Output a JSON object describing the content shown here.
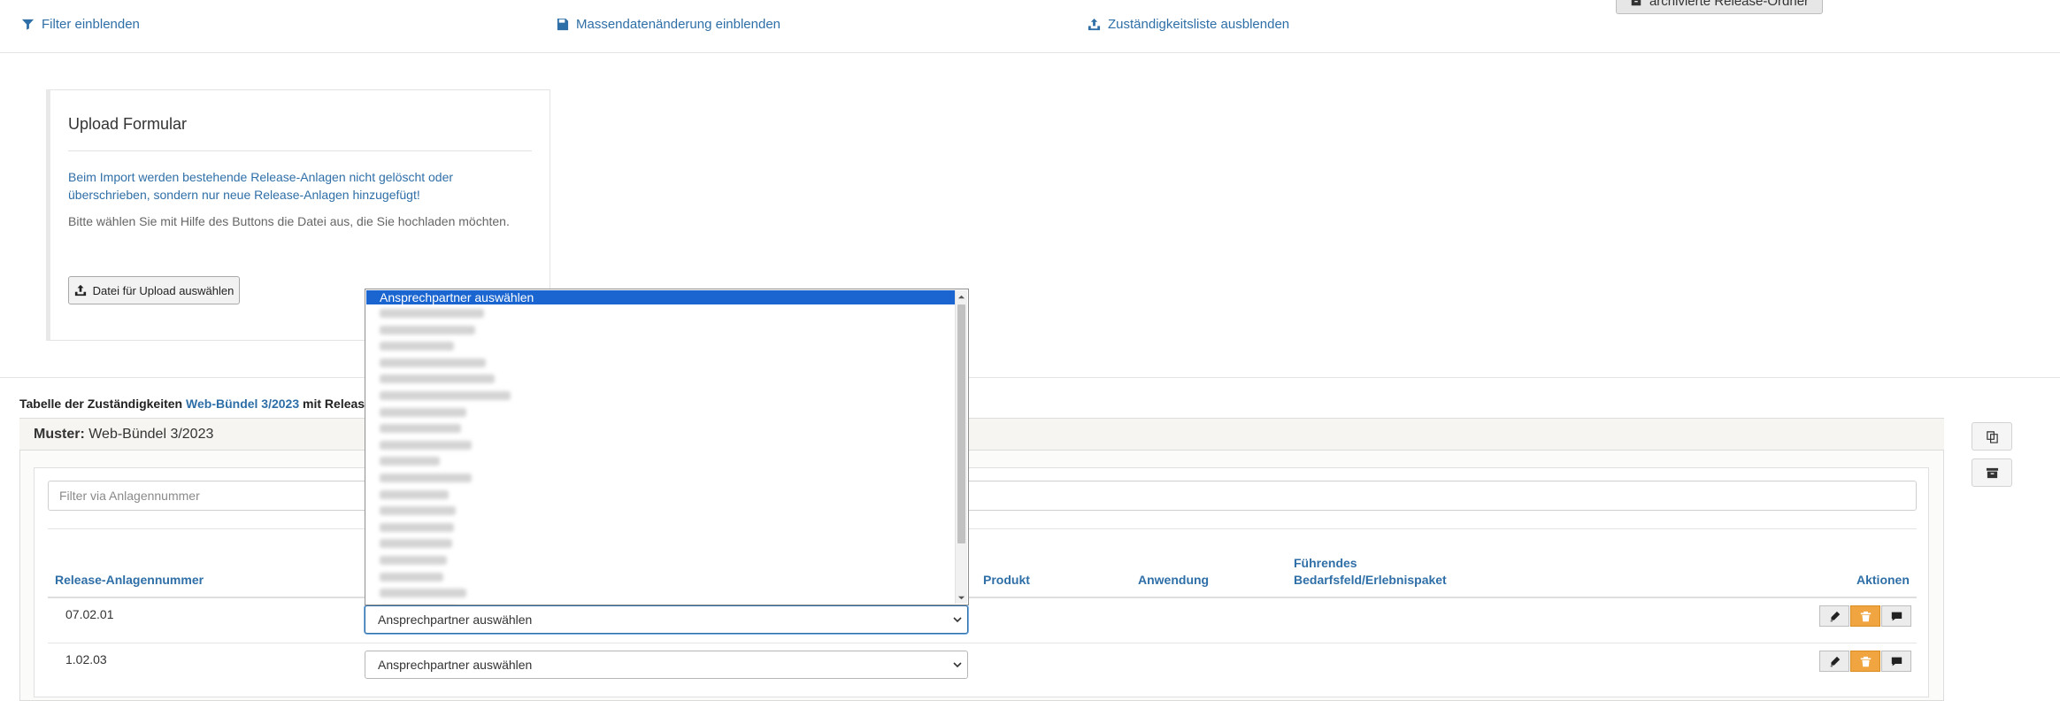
{
  "toolbar": {
    "filter_label": "Filter einblenden",
    "mass_label": "Massendatenänderung einblenden",
    "responsibility_label": "Zuständigkeitsliste ausblenden",
    "archive_label": "archivierte Release-Ordner"
  },
  "upload": {
    "title": "Upload Formular",
    "info": "Beim Import werden bestehende Release-Anlagen nicht gelöscht oder überschrieben, sondern nur neue Release-Anlagen hinzugefügt!",
    "description": "Bitte wählen Sie mit Hilfe des Buttons die Datei aus, die Sie hochladen möchten.",
    "button_label": "Datei für Upload auswählen"
  },
  "table_caption": {
    "prefix": "Tabelle der Zuständigkeiten",
    "bundle": "Web-Bündel 3/2023",
    "suffix": "mit Releas"
  },
  "panel": {
    "label": "Muster:",
    "title": "Web-Bündel 3/2023",
    "filter_placeholder": "Filter via Anlagennummer"
  },
  "columns": {
    "number": "Release-Anlagennummer",
    "produkt": "Produkt",
    "anwendung": "Anwendung",
    "fuehrend_line1": "Führendes",
    "fuehrend_line2": "Bedarfsfeld/Erlebnispaket",
    "aktionen": "Aktionen"
  },
  "rows": [
    {
      "number": "07.02.01",
      "contact": "Ansprechpartner auswählen"
    },
    {
      "number": "1.02.03",
      "contact": "Ansprechpartner auswählen"
    }
  ],
  "dropdown": {
    "selected_option": "Ansprechpartner auswählen"
  },
  "colors": {
    "link": "#2f6fa7",
    "selection": "#1a65d0",
    "delete_button": "#f0a541"
  }
}
